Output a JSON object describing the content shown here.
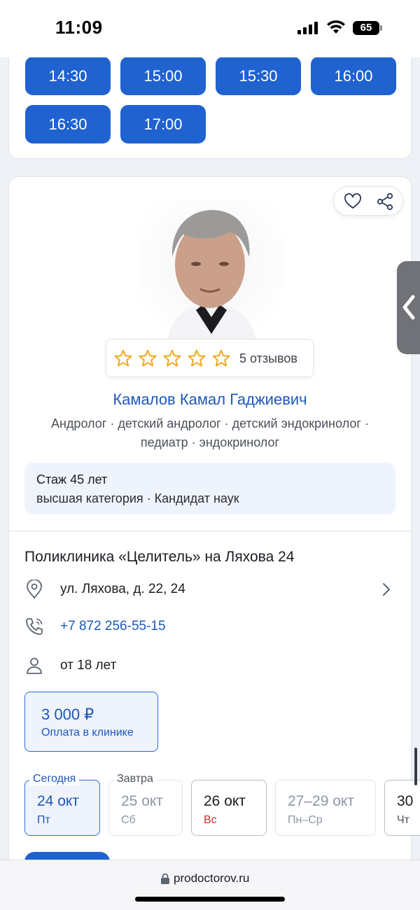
{
  "status_bar": {
    "time": "11:09",
    "battery": "65"
  },
  "time_slots": [
    "14:30",
    "15:00",
    "15:30",
    "16:00",
    "16:30",
    "17:00"
  ],
  "doctor": {
    "name": "Камалов Камал Гаджиевич",
    "specialties_line1": "Андролог · детский андролог · детский эндокринолог ·",
    "specialties_line2": "педиатр · эндокринолог",
    "reviews": "5 отзывов",
    "stars_filled": 0,
    "stars_total": 5,
    "experience": "Стаж 45 лет",
    "qualification": "высшая категория · Кандидат наук"
  },
  "clinic": {
    "name": "Поликлиника «Целитель» на Ляхова 24",
    "address": "ул. Ляхова, д. 22, 24",
    "phone": "+7 872 256-55-15",
    "age": "от 18 лет"
  },
  "price": {
    "value": "3 000 ₽",
    "note": "Оплата в клинике"
  },
  "dates": {
    "today_caption": "Сегодня",
    "tomorrow_caption": "Завтра",
    "tabs": [
      {
        "date": "24 окт",
        "weekday": "Пт"
      },
      {
        "date": "25 окт",
        "weekday": "Сб"
      },
      {
        "date": "26 окт",
        "weekday": "Вс"
      },
      {
        "date": "27–29 окт",
        "weekday": "Пн–Ср"
      },
      {
        "date": "30",
        "weekday": "Чт"
      }
    ]
  },
  "browser": {
    "url": "prodoctorov.ru"
  },
  "colors": {
    "accent": "#1f62d0",
    "link": "#1e58b8",
    "star": "#f2a81d",
    "sunday": "#c9302c"
  }
}
